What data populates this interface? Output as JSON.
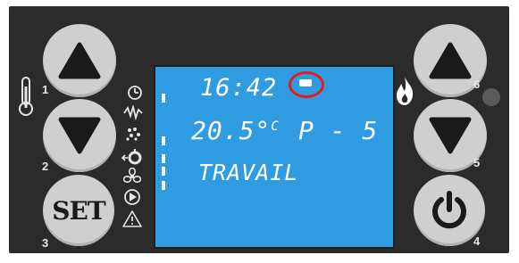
{
  "display": {
    "time": "16:42",
    "temperature": "20.5°",
    "temperature_unit": "C",
    "power": "P - 5",
    "status": "TRAVAIL"
  },
  "buttons": {
    "n1": "1",
    "n2": "2",
    "n3": "3",
    "n4": "4",
    "n5": "5",
    "n6": "6",
    "set_label": "SET"
  },
  "icons": {
    "left_top": "thermometer-icon",
    "screen_side": [
      "clock-icon",
      "spark-icon",
      "pellet-icon",
      "fan-icon",
      "pump-icon",
      "warning-icon"
    ],
    "right": "flame-icon"
  },
  "colors": {
    "lcd": "#2f9be0",
    "highlight": "#e31b23",
    "panel": "#2b2b2b",
    "button": "#cfcfcf"
  }
}
